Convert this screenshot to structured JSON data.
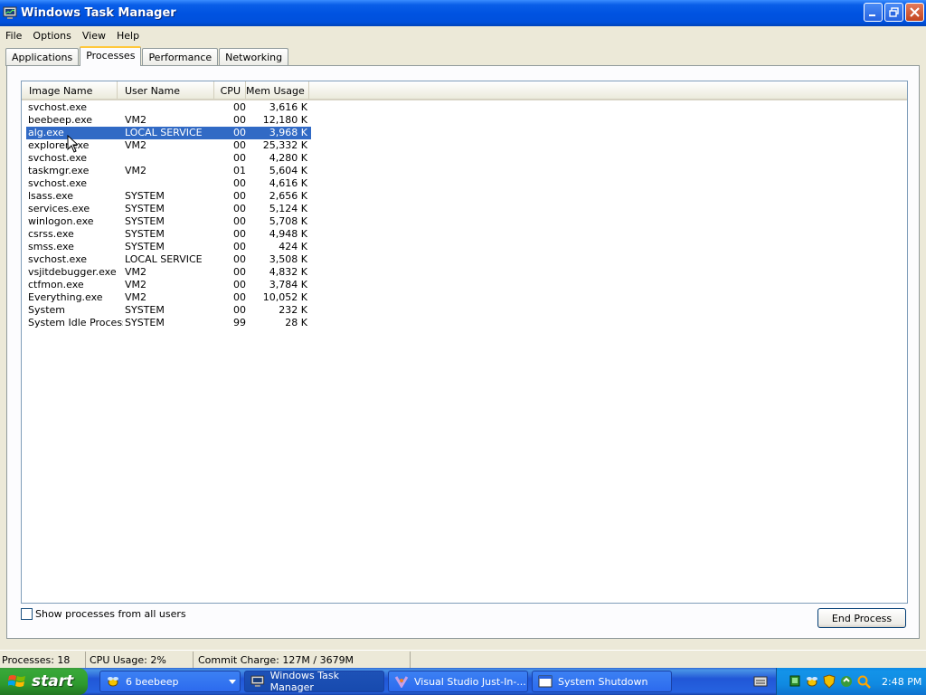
{
  "window": {
    "title": "Windows Task Manager"
  },
  "menu": [
    "File",
    "Options",
    "View",
    "Help"
  ],
  "tabs": [
    {
      "label": "Applications",
      "active": false
    },
    {
      "label": "Processes",
      "active": true
    },
    {
      "label": "Performance",
      "active": false
    },
    {
      "label": "Networking",
      "active": false
    }
  ],
  "processes": {
    "columns": [
      "Image Name",
      "User Name",
      "CPU",
      "Mem Usage"
    ],
    "rows": [
      {
        "name": "svchost.exe",
        "user": "",
        "cpu": "00",
        "mem": "3,616 K"
      },
      {
        "name": "beebeep.exe",
        "user": "VM2",
        "cpu": "00",
        "mem": "12,180 K"
      },
      {
        "name": "alg.exe",
        "user": "LOCAL SERVICE",
        "cpu": "00",
        "mem": "3,968 K",
        "selected": true
      },
      {
        "name": "explorer.exe",
        "user": "VM2",
        "cpu": "00",
        "mem": "25,332 K"
      },
      {
        "name": "svchost.exe",
        "user": "",
        "cpu": "00",
        "mem": "4,280 K"
      },
      {
        "name": "taskmgr.exe",
        "user": "VM2",
        "cpu": "01",
        "mem": "5,604 K"
      },
      {
        "name": "svchost.exe",
        "user": "",
        "cpu": "00",
        "mem": "4,616 K"
      },
      {
        "name": "lsass.exe",
        "user": "SYSTEM",
        "cpu": "00",
        "mem": "2,656 K"
      },
      {
        "name": "services.exe",
        "user": "SYSTEM",
        "cpu": "00",
        "mem": "5,124 K"
      },
      {
        "name": "winlogon.exe",
        "user": "SYSTEM",
        "cpu": "00",
        "mem": "5,708 K"
      },
      {
        "name": "csrss.exe",
        "user": "SYSTEM",
        "cpu": "00",
        "mem": "4,948 K"
      },
      {
        "name": "smss.exe",
        "user": "SYSTEM",
        "cpu": "00",
        "mem": "424 K"
      },
      {
        "name": "svchost.exe",
        "user": "LOCAL SERVICE",
        "cpu": "00",
        "mem": "3,508 K"
      },
      {
        "name": "vsjitdebugger.exe",
        "user": "VM2",
        "cpu": "00",
        "mem": "4,832 K"
      },
      {
        "name": "ctfmon.exe",
        "user": "VM2",
        "cpu": "00",
        "mem": "3,784 K"
      },
      {
        "name": "Everything.exe",
        "user": "VM2",
        "cpu": "00",
        "mem": "10,052 K"
      },
      {
        "name": "System",
        "user": "SYSTEM",
        "cpu": "00",
        "mem": "232 K"
      },
      {
        "name": "System Idle Process",
        "user": "SYSTEM",
        "cpu": "99",
        "mem": "28 K"
      }
    ]
  },
  "controls": {
    "show_all_label": "Show processes from all users",
    "show_all_checked": false,
    "end_process_label": "End Process"
  },
  "status": {
    "processes": "Processes: 18",
    "cpu": "CPU Usage: 2%",
    "commit": "Commit Charge: 127M / 3679M"
  },
  "taskbar": {
    "start_label": "start",
    "buttons": [
      {
        "label": "6 beebeep",
        "icon": "beebeep-icon"
      },
      {
        "label": "Windows Task Manager",
        "icon": "task-manager-icon"
      },
      {
        "label": "Visual Studio Just-In-...",
        "icon": "visual-studio-icon"
      },
      {
        "label": "System Shutdown",
        "icon": "window-icon"
      }
    ],
    "clock": "2:48 PM"
  },
  "colors": {
    "selection": "#316AC5",
    "titlebar": "#0053E1",
    "start_green": "#2E9A2E"
  }
}
